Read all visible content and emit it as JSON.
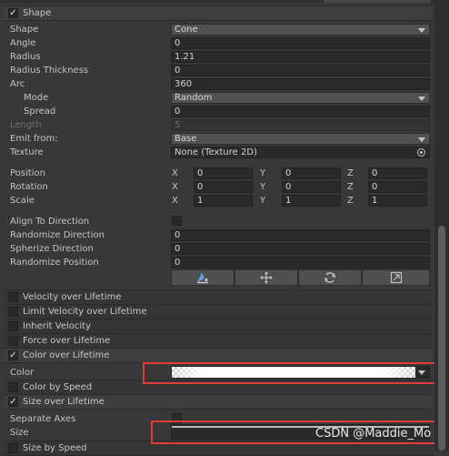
{
  "shape_header": "Shape",
  "shape": {
    "shape_label": "Shape",
    "shape_value": "Cone",
    "angle_label": "Angle",
    "angle_value": "0",
    "radius_label": "Radius",
    "radius_value": "1.21",
    "radius_thickness_label": "Radius Thickness",
    "radius_thickness_value": "0",
    "arc_label": "Arc",
    "arc_value": "360",
    "mode_label": "Mode",
    "mode_value": "Random",
    "spread_label": "Spread",
    "spread_value": "0",
    "length_label": "Length",
    "length_value": "5",
    "emit_from_label": "Emit from:",
    "emit_from_value": "Base",
    "texture_label": "Texture",
    "texture_value": "None (Texture 2D)",
    "position_label": "Position",
    "rotation_label": "Rotation",
    "scale_label": "Scale",
    "axis_x": "X",
    "axis_y": "Y",
    "axis_z": "Z",
    "position": [
      "0",
      "0",
      "0"
    ],
    "rotation": [
      "0",
      "0",
      "0"
    ],
    "scale": [
      "1",
      "1",
      "1"
    ],
    "align_label": "Align To Direction",
    "align_checked": false,
    "randomize_dir_label": "Randomize Direction",
    "randomize_dir_value": "0",
    "spherize_label": "Spherize Direction",
    "spherize_value": "0",
    "randomize_pos_label": "Randomize Position",
    "randomize_pos_value": "0",
    "edit_tools": [
      "shape-edit-icon",
      "move-icon",
      "rotate-icon",
      "scale-icon"
    ]
  },
  "modules": {
    "velocity": "Velocity over Lifetime",
    "limit_velocity": "Limit Velocity over Lifetime",
    "inherit_velocity": "Inherit Velocity",
    "force": "Force over Lifetime",
    "color": "Color over Lifetime",
    "color_by_speed": "Color by Speed",
    "size": "Size over Lifetime",
    "size_by_speed": "Size by Speed"
  },
  "color_over_lifetime": {
    "color_label": "Color"
  },
  "size_over_lifetime": {
    "separate_axes_label": "Separate Axes",
    "separate_axes_checked": false,
    "size_label": "Size"
  },
  "watermark": "CSDN @Maddie_Mo",
  "colors": {
    "highlight": "#e53a3a",
    "panel": "#383838",
    "field": "#2a2a2a"
  }
}
